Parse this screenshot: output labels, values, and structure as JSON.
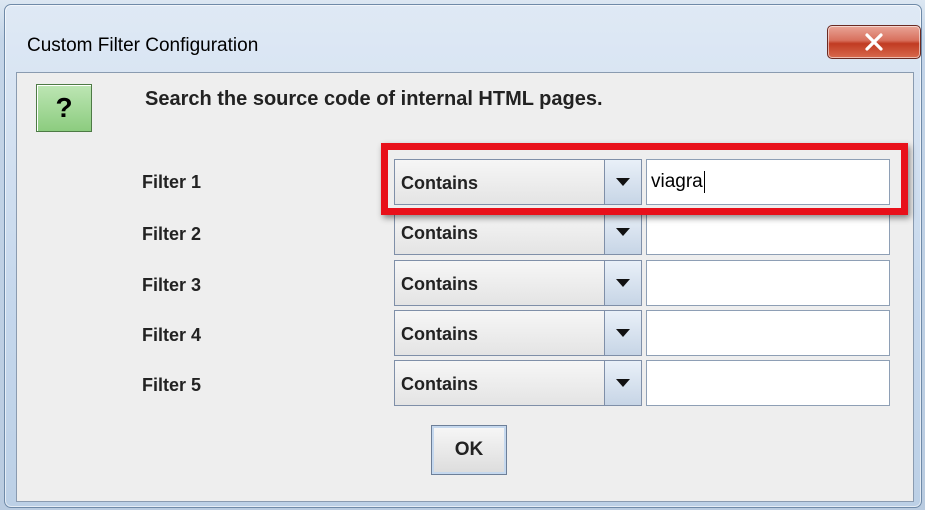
{
  "window": {
    "title": "Custom Filter Configuration",
    "close_label": "X"
  },
  "dialog": {
    "icon": "question-icon",
    "icon_glyph": "?",
    "message": "Search the source code of internal HTML pages.",
    "filters": [
      {
        "label": "Filter 1",
        "mode": "Contains",
        "value": "viagra"
      },
      {
        "label": "Filter 2",
        "mode": "Contains",
        "value": ""
      },
      {
        "label": "Filter 3",
        "mode": "Contains",
        "value": ""
      },
      {
        "label": "Filter 4",
        "mode": "Contains",
        "value": ""
      },
      {
        "label": "Filter 5",
        "mode": "Contains",
        "value": ""
      }
    ],
    "ok_label": "OK"
  },
  "annotation": {
    "highlight_color": "#e8101a"
  }
}
